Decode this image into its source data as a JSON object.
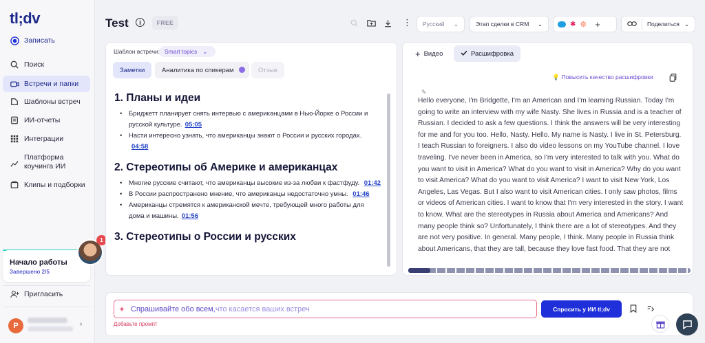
{
  "sidebar": {
    "logo": "tl;dv",
    "record": "Записать",
    "items": [
      {
        "label": "Поиск",
        "icon": "search-icon"
      },
      {
        "label": "Встречи и папки",
        "icon": "video-icon"
      },
      {
        "label": "Шаблоны встреч",
        "icon": "template-icon"
      },
      {
        "label": "ИИ-отчеты",
        "icon": "report-icon"
      },
      {
        "label": "Интеграции",
        "icon": "grid-icon"
      },
      {
        "label": "Платформа коучинга ИИ",
        "icon": "chart-icon"
      },
      {
        "label": "Клипы и подборки",
        "icon": "clips-icon"
      }
    ],
    "onboarding": {
      "title": "Начало работы",
      "subtitle": "Завершено 2/5",
      "notifications": "1"
    },
    "invite": "Пригласить",
    "user_initial": "P"
  },
  "header": {
    "title": "Test",
    "badge": "FREE",
    "language": "Русский",
    "crm_stage": "Этап сделки в CRM",
    "share": "Поделиться"
  },
  "left_panel": {
    "template_label": "Шаблон встречи:",
    "template_value": "Smart topics",
    "tabs": [
      "Заметки",
      "Аналитика по спикерам",
      "Отзыв"
    ],
    "sections": [
      {
        "heading": "1. Планы и идеи",
        "bullets": [
          {
            "text": "Бриджетт планирует снять интервью с американцами в Нью-Йорке о России и русской культуре.",
            "ts": "05:05"
          },
          {
            "text": "Насти интересно узнать, что американцы знают о России и русских городах.",
            "ts": "04:58"
          }
        ]
      },
      {
        "heading": "2. Стереотипы об Америке и американцах",
        "bullets": [
          {
            "text": "Многие русские считают, что американцы высокие из-за любви к фастфуду.",
            "ts": "01:42"
          },
          {
            "text": "В России распространено мнение, что американцы недостаточно умны.",
            "ts": "01:46"
          },
          {
            "text": "Американцы стремятся к американской мечте, требующей много работы для дома и машины.",
            "ts": "01:56"
          }
        ]
      },
      {
        "heading": "3. Стереотипы о России и русских",
        "bullets": []
      }
    ]
  },
  "right_panel": {
    "tab_video": "Видео",
    "tab_transcript": "Расшифровка",
    "improve": "Повысить качество расшифровки",
    "transcript": "Hello everyone, I'm Bridgette, I'm an American and I'm learning Russian. Today I'm going to write an interview with my wife Nasty. She lives in Russia and is a teacher of Russian. I decided to ask a few questions. I think the answers will be very interesting for me and for you too. Hello, Nasty. Hello. My name is Nasty. I live in St. Petersburg. I teach Russian to foreigners. I also do video lessons on my YouTube channel. I love traveling. I've never been in America, so I'm very interested to talk with you. What do you want to visit in America? What do you want to visit in America? Why do you want to visit America? What do you want to visit America? I want to visit New York, Los Angeles, Las Vegas. But I also want to visit American cities. I only saw photos, films or videos of American cities. I want to know that I'm very interested in the story. I want to know. What are the stereotypes in Russia about America and Americans? And many people think so? Unfortunately, I think there are a lot of stereotypes. And they are not very positive. In general. Many people, I think. Many people in Russia think about Americans, that they are tall, because they love fast food. That they are not very smart. That they"
  },
  "ask": {
    "placeholder_part1": "Спрашивайте обо всем, ",
    "placeholder_part2": "что касается ваших встреч",
    "add_prompt": "Добавьте промпт",
    "button": "Спросить у ИИ tl;dv"
  }
}
